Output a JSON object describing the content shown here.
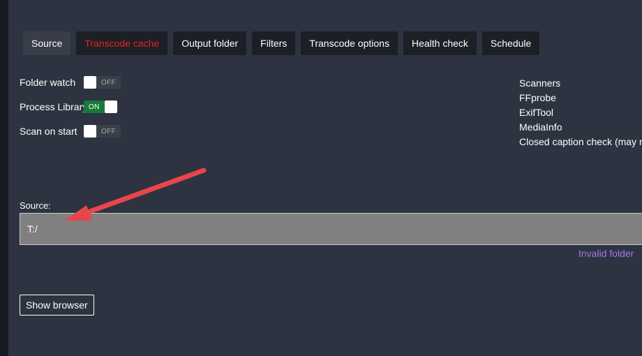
{
  "tabs": [
    {
      "label": "Source",
      "active": true
    },
    {
      "label": "Transcode cache",
      "danger": true
    },
    {
      "label": "Output folder"
    },
    {
      "label": "Filters"
    },
    {
      "label": "Transcode options"
    },
    {
      "label": "Health check"
    },
    {
      "label": "Schedule"
    }
  ],
  "toggles": {
    "folder_watch": {
      "label": "Folder watch",
      "state": "OFF"
    },
    "process_library": {
      "label": "Process Library",
      "state": "ON"
    },
    "scan_on_start": {
      "label": "Scan on start",
      "state": "OFF"
    }
  },
  "scanners": {
    "title": "Scanners",
    "items": [
      "FFprobe",
      "ExifTool",
      "MediaInfo",
      "Closed caption check (may m"
    ]
  },
  "source": {
    "label": "Source:",
    "value": "T:/",
    "error": "Invalid folder"
  },
  "show_browser_label": "Show browser",
  "colors": {
    "background": "#2d3340",
    "tab_bg": "#1c1f26",
    "danger": "#e8231d",
    "toggle_on": "#157a3a",
    "error_text": "#a579e8",
    "annotation_arrow": "#e8454d"
  }
}
